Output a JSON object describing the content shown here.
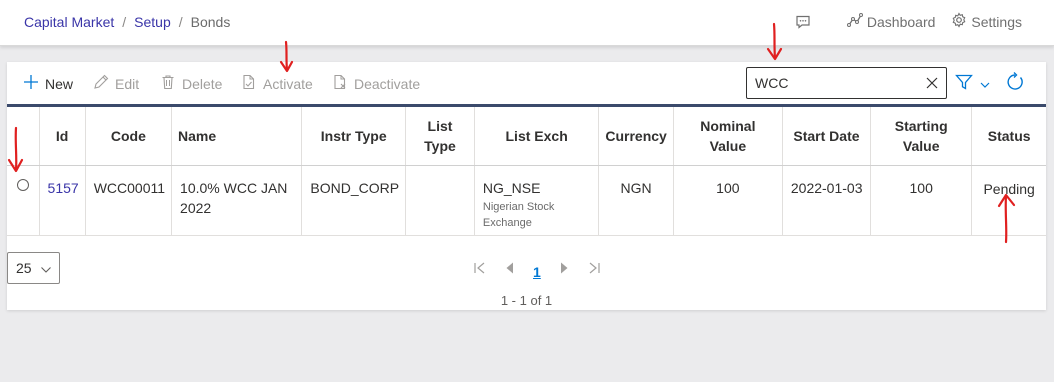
{
  "breadcrumb": {
    "item1": "Capital Market",
    "item2": "Setup",
    "item3": "Bonds",
    "separator": "/"
  },
  "topnav": {
    "chat_icon": "chat-icon",
    "dashboard": "Dashboard",
    "settings": "Settings"
  },
  "toolbar": {
    "new": "New",
    "edit": "Edit",
    "delete": "Delete",
    "activate": "Activate",
    "deactivate": "Deactivate"
  },
  "search": {
    "value": "WCC"
  },
  "grid": {
    "headers": {
      "id": "Id",
      "code": "Code",
      "name": "Name",
      "instr_type": "Instr Type",
      "list_type_l1": "List",
      "list_type_l2": "Type",
      "list_exch": "List Exch",
      "currency": "Currency",
      "nominal_value_l1": "Nominal",
      "nominal_value_l2": "Value",
      "start_date": "Start Date",
      "starting_value_l1": "Starting",
      "starting_value_l2": "Value",
      "status": "Status"
    },
    "rows": [
      {
        "id": "5157",
        "code": "WCC00011",
        "name_l1": "10.0% WCC JAN",
        "name_l2": "2022",
        "instr_type": "BOND_CORP",
        "list_type": "",
        "list_exch": "NG_NSE",
        "list_exch_desc_l1": "Nigerian Stock",
        "list_exch_desc_l2": "Exchange",
        "currency": "NGN",
        "nominal_value": "100",
        "start_date": "2022-01-03",
        "starting_value": "100",
        "status": "Pending"
      }
    ]
  },
  "pager": {
    "page_size": "25",
    "current_page": "1",
    "info": "1 - 1 of 1"
  },
  "colors": {
    "link": "#3a35a8",
    "accent": "#0078d4",
    "grid_top_border": "#3b4a6b",
    "annotation": "#e02020"
  }
}
